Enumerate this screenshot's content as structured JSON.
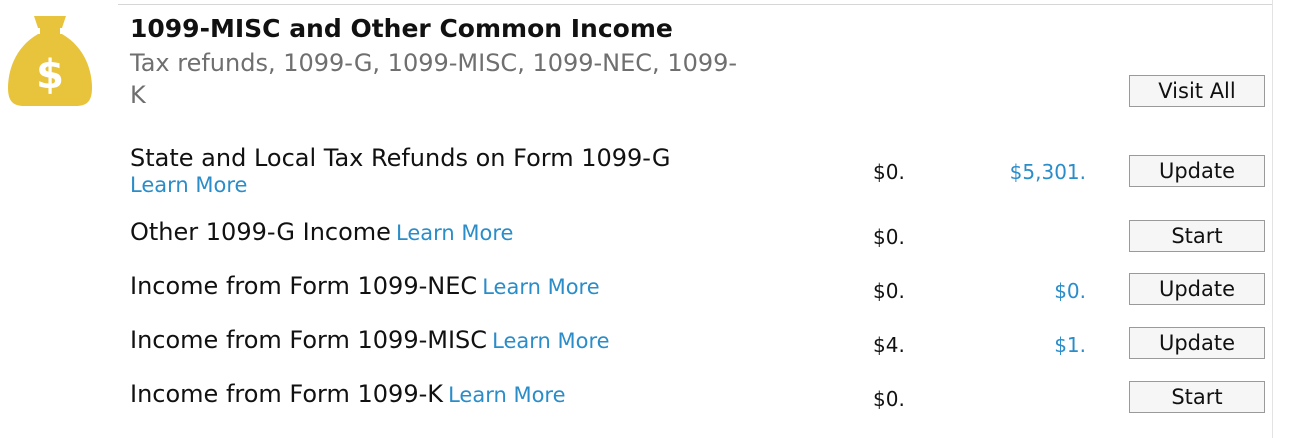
{
  "section": {
    "title": "1099-MISC and Other Common Income",
    "subtitle": "Tax refunds, 1099-G, 1099-MISC, 1099-NEC, 1099-K",
    "icon": "money-bag-icon",
    "icon_color": "#e8c43c",
    "visit_all_label": "Visit All"
  },
  "rows": [
    {
      "label": "State and Local Tax Refunds on Form 1099-G",
      "learn_more": "Learn More",
      "prior_year": "$0.",
      "current_year": "$5,301.",
      "action": "Update"
    },
    {
      "label": "Other 1099-G Income",
      "learn_more": "Learn More",
      "prior_year": "$0.",
      "current_year": "",
      "action": "Start"
    },
    {
      "label": "Income from Form 1099-NEC",
      "learn_more": "Learn More",
      "prior_year": "$0.",
      "current_year": "$0.",
      "action": "Update"
    },
    {
      "label": "Income from Form 1099-MISC",
      "learn_more": "Learn More",
      "prior_year": "$4.",
      "current_year": "$1.",
      "action": "Update"
    },
    {
      "label": "Income from Form 1099-K",
      "learn_more": "Learn More",
      "prior_year": "$0.",
      "current_year": "",
      "action": "Start"
    }
  ],
  "colors": {
    "link": "#2a8dc9",
    "subtitle": "#6f6f6f"
  }
}
